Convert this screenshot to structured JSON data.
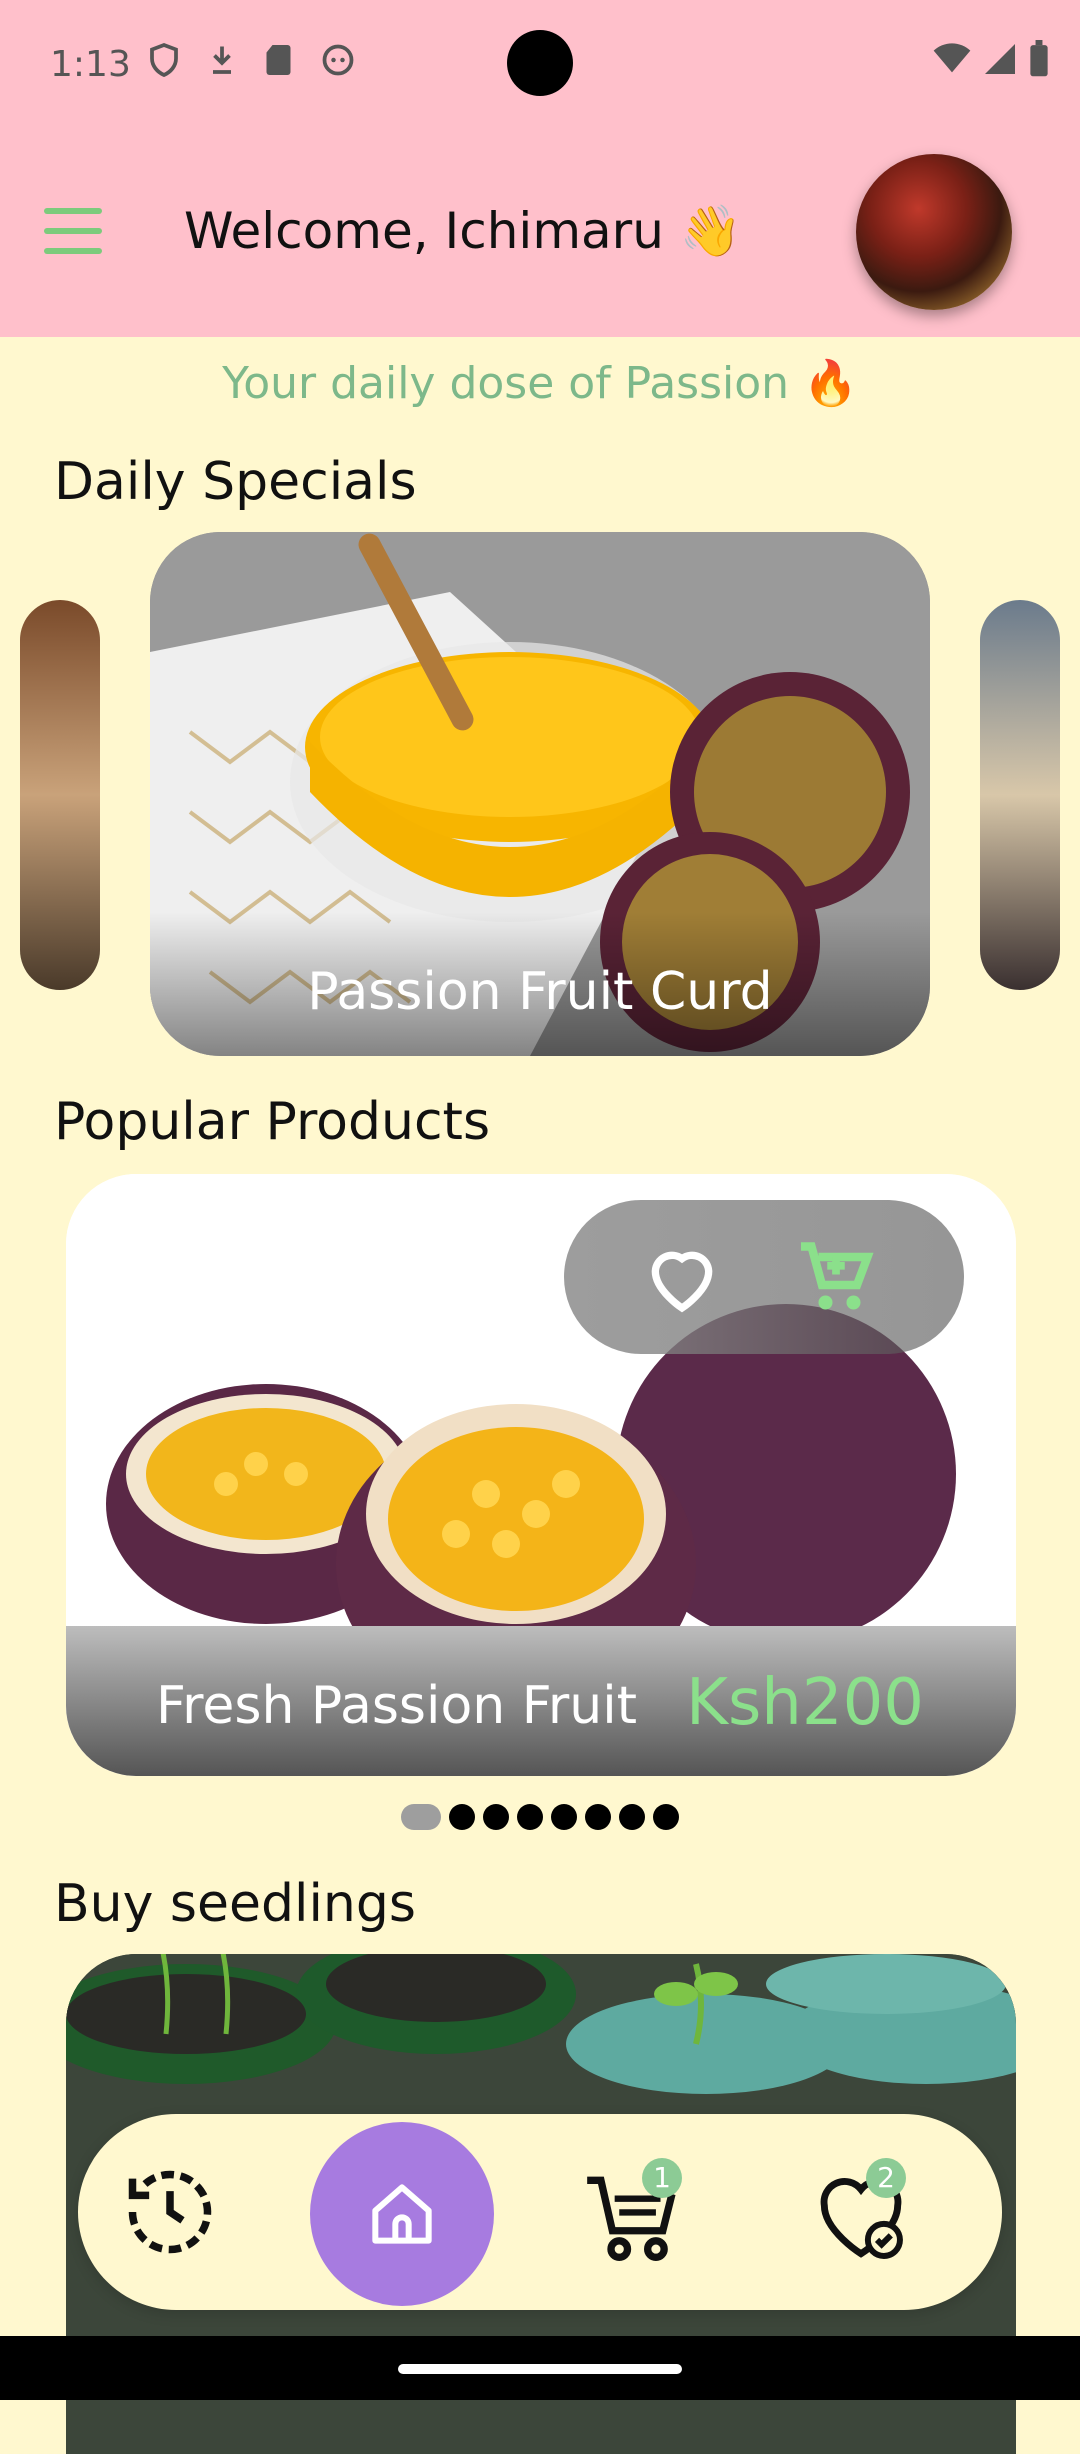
{
  "status_bar": {
    "time": "1:13"
  },
  "header": {
    "welcome_text": "Welcome, Ichimaru 👋"
  },
  "subtitle": "Your daily dose of Passion 🔥",
  "sections": {
    "daily_specials": "Daily Specials",
    "popular_products": "Popular Products",
    "buy_seedlings": "Buy seedlings"
  },
  "daily_special": {
    "caption": "Passion Fruit Curd"
  },
  "popular_product": {
    "name": "Fresh Passion Fruit",
    "price": "Ksh200"
  },
  "pager": {
    "total": 8,
    "active_index": 0
  },
  "bottom_nav": {
    "cart_badge": "1",
    "wishlist_badge": "2"
  },
  "colors": {
    "header_bg": "#FFC0CB",
    "page_bg": "#FFF8CF",
    "accent_green": "#7CCB7C",
    "home_purple": "#A77BE0"
  }
}
